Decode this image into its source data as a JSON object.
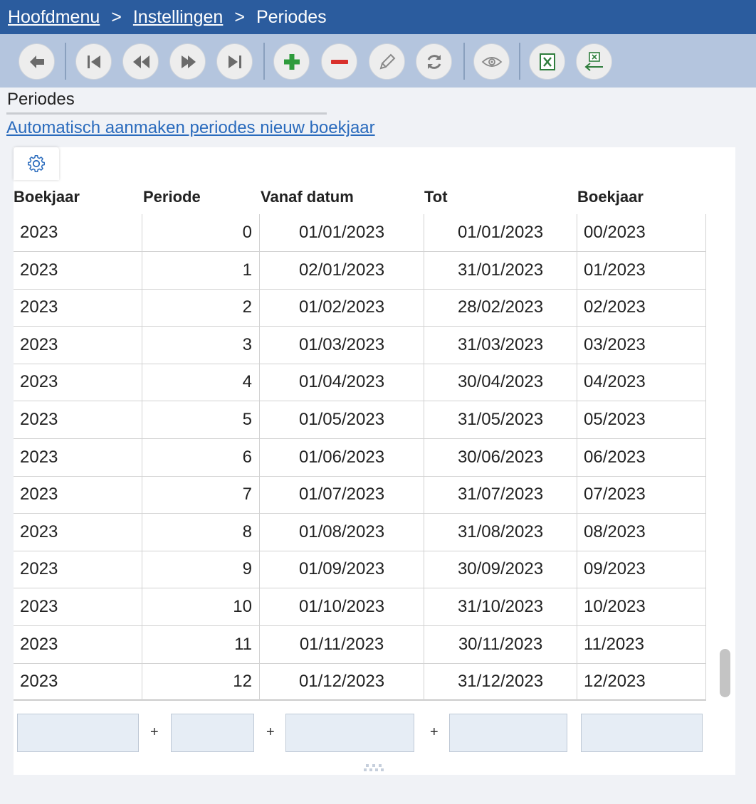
{
  "breadcrumb": {
    "items": [
      "Hoofdmenu",
      "Instellingen"
    ],
    "separator": ">",
    "current": "Periodes"
  },
  "toolbar": {
    "buttons": [
      {
        "name": "back-icon"
      },
      {
        "name": "first-record-icon"
      },
      {
        "name": "previous-record-icon"
      },
      {
        "name": "next-record-icon"
      },
      {
        "name": "last-record-icon"
      },
      {
        "name": "add-icon",
        "color": "#2e9b3c"
      },
      {
        "name": "delete-icon",
        "color": "#d9302b"
      },
      {
        "name": "edit-icon"
      },
      {
        "name": "refresh-icon"
      },
      {
        "name": "view-icon"
      },
      {
        "name": "export-excel-icon",
        "color": "#2e7d3c"
      },
      {
        "name": "import-excel-icon",
        "color": "#2e7d3c"
      }
    ]
  },
  "section": {
    "title": "Periodes",
    "link": "Automatisch aanmaken periodes nieuw boekjaar"
  },
  "table": {
    "columns": [
      "Boekjaar",
      "Periode",
      "Vanaf datum",
      "Tot",
      "Boekjaar"
    ],
    "rows": [
      [
        "2023",
        "0",
        "01/01/2023",
        "01/01/2023",
        "00/2023"
      ],
      [
        "2023",
        "1",
        "02/01/2023",
        "31/01/2023",
        "01/2023"
      ],
      [
        "2023",
        "2",
        "01/02/2023",
        "28/02/2023",
        "02/2023"
      ],
      [
        "2023",
        "3",
        "01/03/2023",
        "31/03/2023",
        "03/2023"
      ],
      [
        "2023",
        "4",
        "01/04/2023",
        "30/04/2023",
        "04/2023"
      ],
      [
        "2023",
        "5",
        "01/05/2023",
        "31/05/2023",
        "05/2023"
      ],
      [
        "2023",
        "6",
        "01/06/2023",
        "30/06/2023",
        "06/2023"
      ],
      [
        "2023",
        "7",
        "01/07/2023",
        "31/07/2023",
        "07/2023"
      ],
      [
        "2023",
        "8",
        "01/08/2023",
        "31/08/2023",
        "08/2023"
      ],
      [
        "2023",
        "9",
        "01/09/2023",
        "30/09/2023",
        "09/2023"
      ],
      [
        "2023",
        "10",
        "01/10/2023",
        "31/10/2023",
        "10/2023"
      ],
      [
        "2023",
        "11",
        "01/11/2023",
        "30/11/2023",
        "11/2023"
      ],
      [
        "2023",
        "12",
        "01/12/2023",
        "31/12/2023",
        "12/2023"
      ]
    ]
  },
  "footer": {
    "filter_values": [
      "",
      "",
      "",
      "",
      ""
    ],
    "plus_symbol": "+"
  },
  "colors": {
    "header_bar": "#2b5c9e",
    "toolbar": "#b4c5de",
    "link": "#2a6bbd"
  }
}
